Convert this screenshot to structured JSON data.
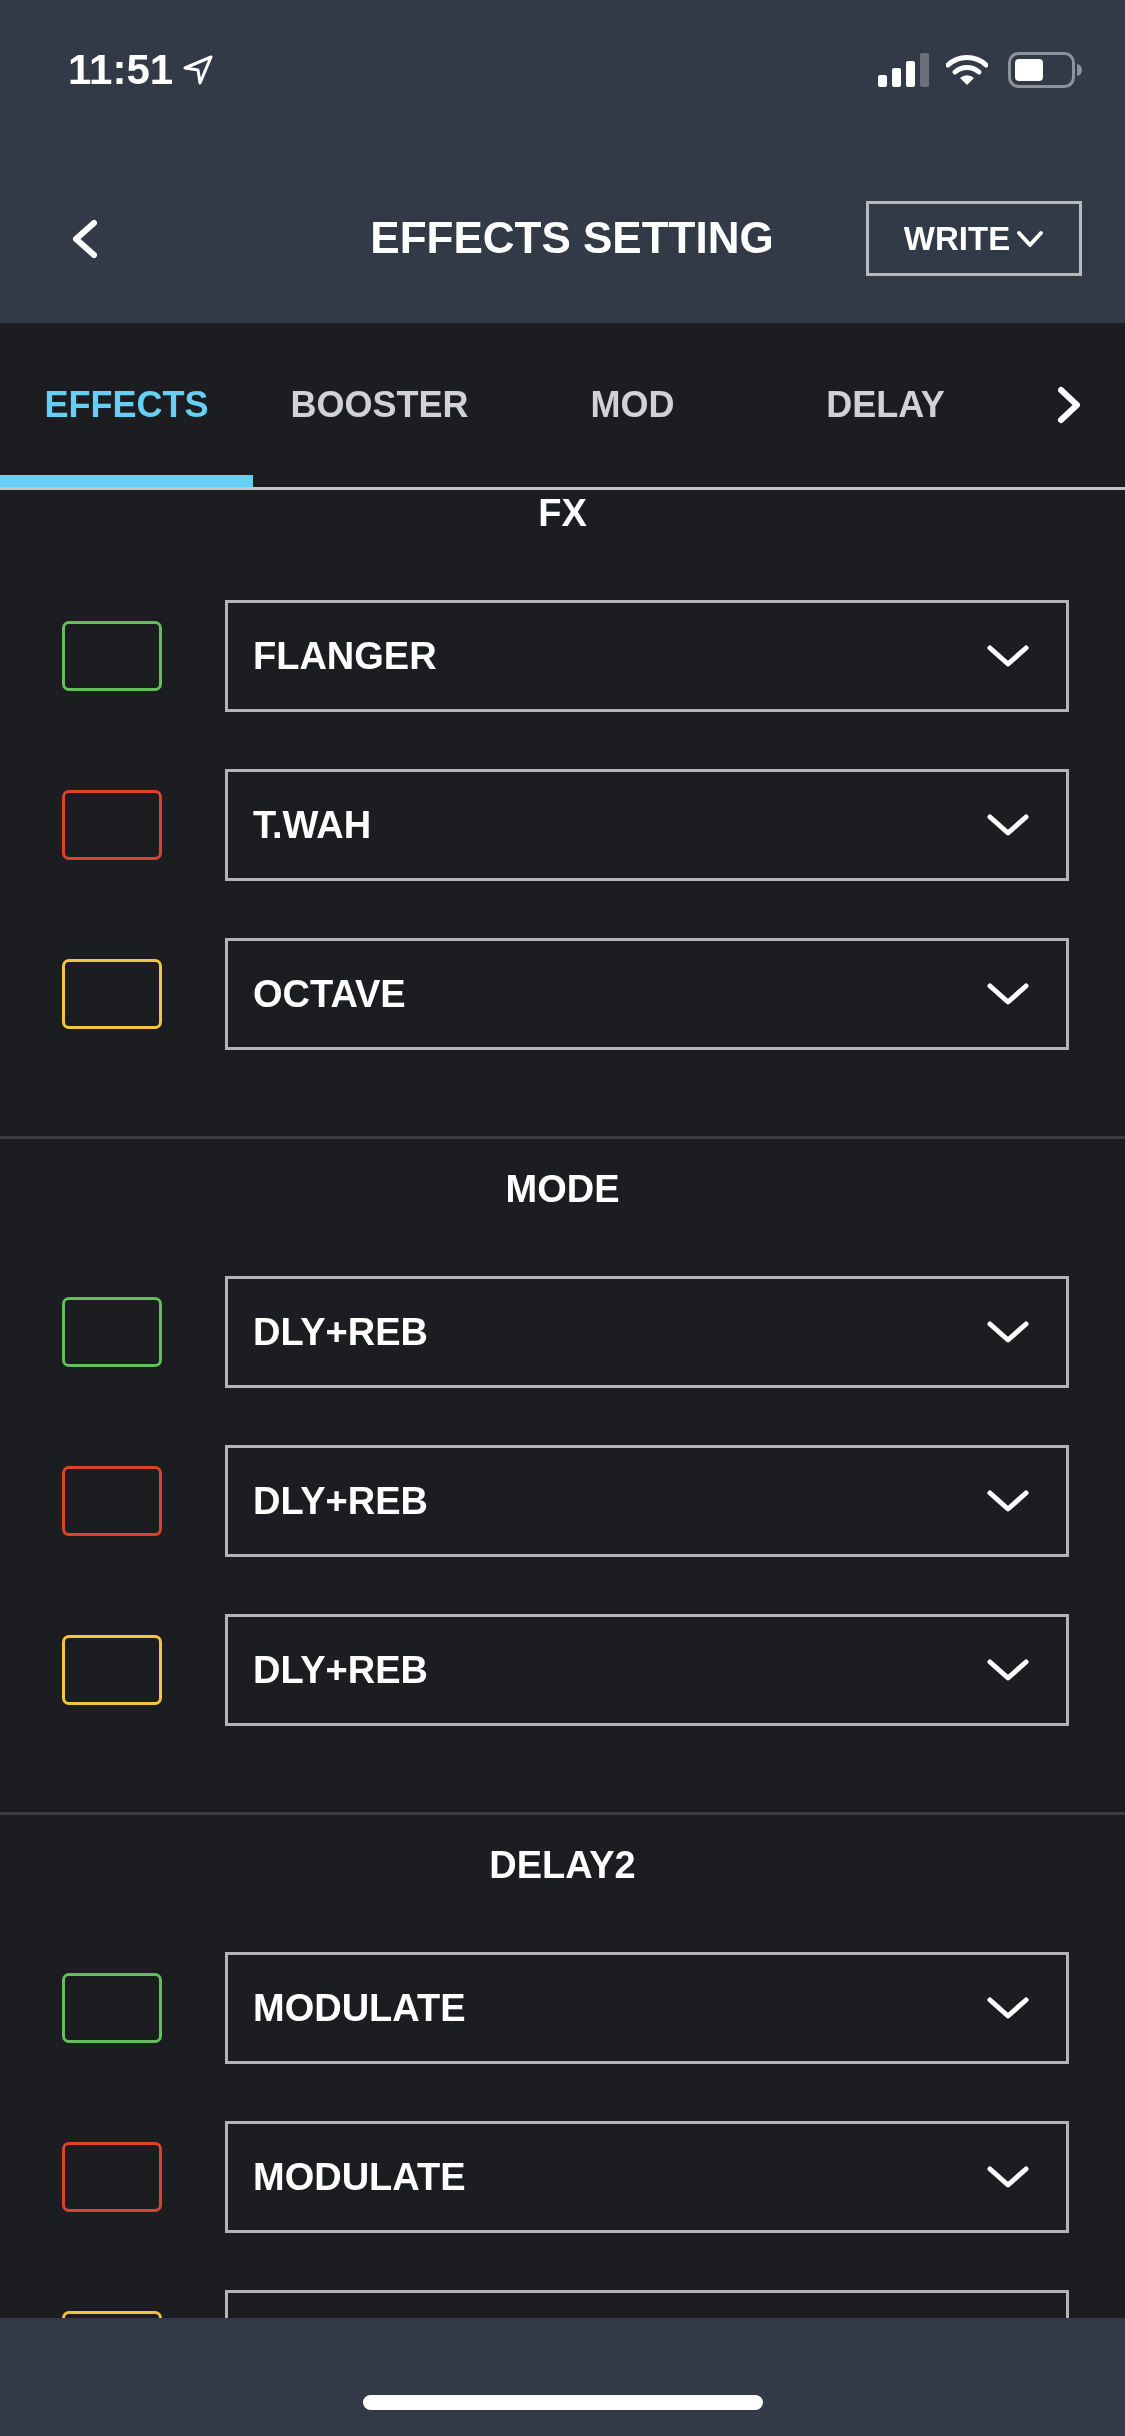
{
  "status_bar": {
    "time": "11:51"
  },
  "header": {
    "title": "EFFECTS SETTING",
    "write_button": "WRITE"
  },
  "tabs": [
    {
      "label": "EFFECTS",
      "selected": true
    },
    {
      "label": "BOOSTER",
      "selected": false
    },
    {
      "label": "MOD",
      "selected": false
    },
    {
      "label": "DELAY",
      "selected": false
    }
  ],
  "sections": [
    {
      "title": "FX",
      "rows": [
        {
          "color": "#62bf5a",
          "value": "FLANGER"
        },
        {
          "color": "#dc4327",
          "value": "T.WAH"
        },
        {
          "color": "#f2c53d",
          "value": "OCTAVE"
        }
      ]
    },
    {
      "title": "MODE",
      "rows": [
        {
          "color": "#62bf5a",
          "value": "DLY+REB"
        },
        {
          "color": "#dc4327",
          "value": "DLY+REB"
        },
        {
          "color": "#f2c53d",
          "value": "DLY+REB"
        }
      ]
    },
    {
      "title": "DELAY2",
      "rows": [
        {
          "color": "#62bf5a",
          "value": "MODULATE"
        },
        {
          "color": "#dc4327",
          "value": "MODULATE"
        },
        {
          "color": "#f2c53d"
        }
      ]
    }
  ]
}
